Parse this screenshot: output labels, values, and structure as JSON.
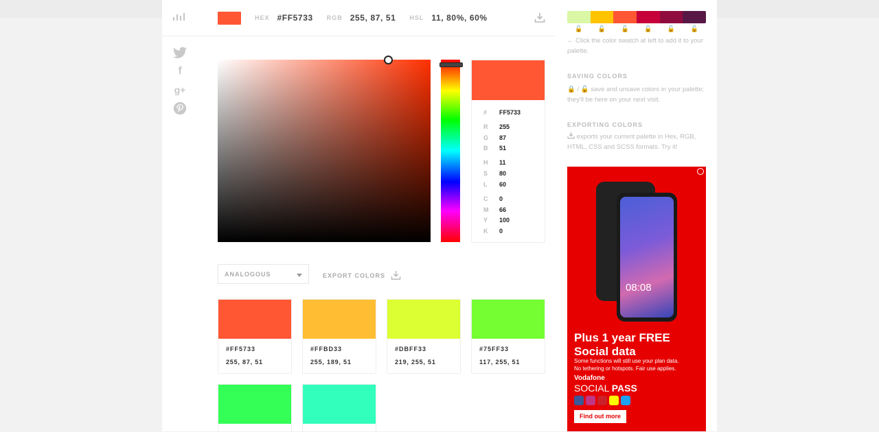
{
  "topbar": {
    "hex_label": "HEX",
    "hex_value": "#FF5733",
    "rgb_label": "RGB",
    "rgb_value": "255, 87, 51",
    "hsl_label": "HSL",
    "hsl_value": "11, 80%, 60%",
    "current_color": "#FF5733"
  },
  "info": {
    "hash_label": "#",
    "hash_value": "FF5733",
    "r_label": "R",
    "r": "255",
    "g_label": "G",
    "g": "87",
    "b_label": "B",
    "b": "51",
    "h_label": "H",
    "h": "11",
    "s_label": "S",
    "s": "80",
    "l_label": "L",
    "l": "60",
    "c_label": "C",
    "c": "0",
    "m_label": "M",
    "m": "66",
    "y_label": "Y",
    "y": "100",
    "k_label": "K",
    "k": "0"
  },
  "scheme": {
    "selected": "ANALOGOUS"
  },
  "export": {
    "label": "EXPORT COLORS"
  },
  "cards": [
    {
      "color": "#FF5733",
      "hex": "#FF5733",
      "rgb": "255, 87, 51"
    },
    {
      "color": "#FFBD33",
      "hex": "#FFBD33",
      "rgb": "255, 189, 51"
    },
    {
      "color": "#DBFF33",
      "hex": "#DBFF33",
      "rgb": "219, 255, 51"
    },
    {
      "color": "#75FF33",
      "hex": "#75FF33",
      "rgb": "117, 255, 51"
    },
    {
      "color": "#33FF57",
      "hex": "",
      "rgb": ""
    },
    {
      "color": "#33FFBD",
      "hex": "",
      "rgb": ""
    }
  ],
  "palette": [
    "#DAF7A6",
    "#FFC300",
    "#FF5733",
    "#C70039",
    "#900C3F",
    "#581845"
  ],
  "help": {
    "add_text": "Click the color swatch at left to add it to your palette.",
    "saving_heading": "SAVING COLORS",
    "saving_sep": "/",
    "saving_text": "save and unsave colors in your palette; they'll be here on your next visit.",
    "exporting_heading": "EXPORTING COLORS",
    "exporting_text": "exports your current palette in Hex, RGB, HTML, CSS and SCSS formats. Try it!"
  },
  "ad": {
    "clock": "08:08",
    "title_line1": "Plus 1 year FREE",
    "title_line2": "Social data",
    "small_line1": "Some functions will still use your plan data.",
    "small_line2": "No tethering or hotspots. Fair use applies.",
    "brand": "Vodafone",
    "pass_part1": "SOCIAL ",
    "pass_part2": "PASS",
    "cta": "Find out more"
  }
}
